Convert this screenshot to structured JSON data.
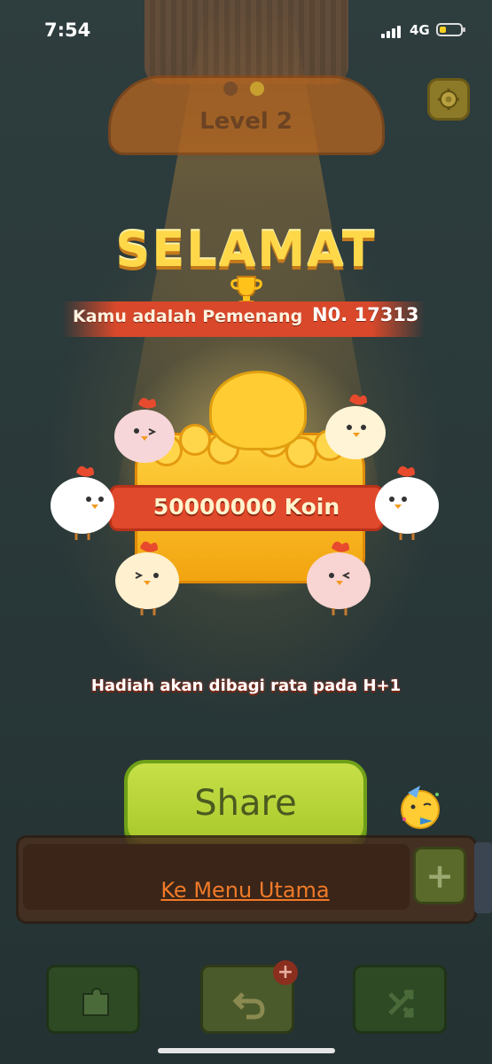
{
  "status_bar": {
    "time": "7:54",
    "network": "4G"
  },
  "level": {
    "label": "Level  2"
  },
  "congrats": {
    "title": "SELAMAT",
    "winner_label": "Kamu adalah Pemenang",
    "winner_number": "N0. 17313"
  },
  "reward": {
    "amount_label": "50000000 Koin",
    "note": "Hadiah akan dibagi rata pada H+1"
  },
  "actions": {
    "share_label": "Share",
    "main_menu_label": "Ke Menu Utama",
    "plus_label": "+",
    "undo_badge": "+"
  },
  "icons": {
    "settings": "gear-icon",
    "puzzle": "puzzle-icon",
    "undo": "undo-icon",
    "shuffle": "shuffle-icon",
    "trophy": "trophy-icon",
    "party": "party-emoji-icon"
  },
  "colors": {
    "accent_green": "#a8c82a",
    "banner_red": "#e0492b",
    "title_gold": "#ffd84a",
    "link_orange": "#f07a28"
  }
}
